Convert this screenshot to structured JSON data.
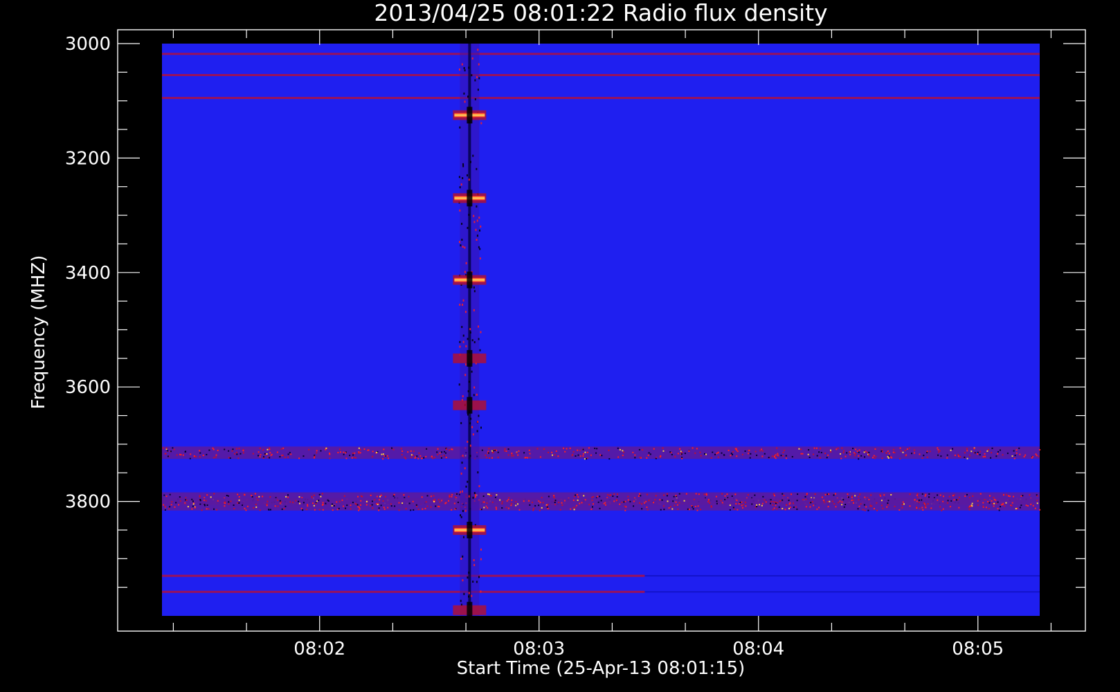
{
  "chart_data": {
    "type": "heatmap",
    "title": "2013/04/25 08:01:22 Radio flux density",
    "xlabel": "Start Time (25-Apr-13 08:01:15)",
    "ylabel": "Frequency (MHZ)",
    "x_ticks": [
      "08:02",
      "08:03",
      "08:04",
      "08:05"
    ],
    "y_ticks": [
      "3000",
      "3200",
      "3400",
      "3600",
      "3800"
    ],
    "ylim": [
      3000,
      4000
    ],
    "y_inverted": true,
    "grid": false,
    "colormap": [
      "#000000",
      "#2a1ad8",
      "#0000ff",
      "#d01010",
      "#ffd040",
      "#ffffff"
    ],
    "background_color": "#1f1ff0",
    "frame_color": "#ffffff",
    "series": [
      {
        "kind": "horizontal_band",
        "freq_mhz": 3018,
        "intensity": "moderate",
        "extent": "full"
      },
      {
        "kind": "horizontal_band",
        "freq_mhz": 3055,
        "intensity": "moderate",
        "extent": "full"
      },
      {
        "kind": "horizontal_band",
        "freq_mhz": 3095,
        "intensity": "moderate",
        "extent": "full"
      },
      {
        "kind": "horizontal_band",
        "freq_mhz": 3715,
        "intensity": "high",
        "extent": "full"
      },
      {
        "kind": "horizontal_band",
        "freq_mhz": 3795,
        "intensity": "high",
        "extent": "full"
      },
      {
        "kind": "horizontal_band",
        "freq_mhz": 3805,
        "intensity": "high",
        "extent": "full"
      },
      {
        "kind": "horizontal_band",
        "freq_mhz": 3930,
        "intensity": "moderate",
        "extent": "partial"
      },
      {
        "kind": "horizontal_band",
        "freq_mhz": 3958,
        "intensity": "moderate",
        "extent": "partial"
      },
      {
        "kind": "vertical_burst",
        "time": "08:02:41",
        "freq_range_mhz": [
          3000,
          4000
        ]
      },
      {
        "kind": "burst_blob",
        "time": "08:02:41",
        "freq_mhz": 3125,
        "intensity": "high"
      },
      {
        "kind": "burst_blob",
        "time": "08:02:41",
        "freq_mhz": 3270,
        "intensity": "high"
      },
      {
        "kind": "burst_blob",
        "time": "08:02:41",
        "freq_mhz": 3413,
        "intensity": "high"
      },
      {
        "kind": "burst_blob",
        "time": "08:02:41",
        "freq_mhz": 3550,
        "intensity": "moderate"
      },
      {
        "kind": "burst_blob",
        "time": "08:02:41",
        "freq_mhz": 3632,
        "intensity": "moderate"
      },
      {
        "kind": "burst_blob",
        "time": "08:02:41",
        "freq_mhz": 3850,
        "intensity": "high"
      },
      {
        "kind": "burst_blob",
        "time": "08:02:41",
        "freq_mhz": 3990,
        "intensity": "moderate"
      }
    ]
  }
}
